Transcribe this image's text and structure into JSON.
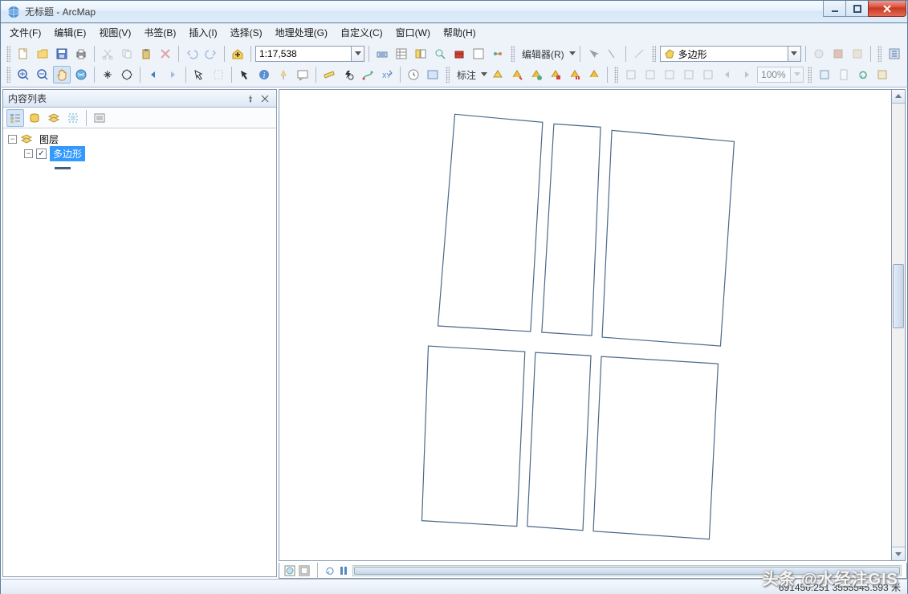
{
  "window": {
    "title": "无标题 - ArcMap"
  },
  "menu": [
    "文件(F)",
    "编辑(E)",
    "视图(V)",
    "书签(B)",
    "插入(I)",
    "选择(S)",
    "地理处理(G)",
    "自定义(C)",
    "窗口(W)",
    "帮助(H)"
  ],
  "toolbar": {
    "scale": "1:17,538",
    "editor_label": "编辑器(R)",
    "labeling_label": "标注",
    "feature_template": "多边形",
    "zoom_pct": "100%"
  },
  "toc": {
    "title": "内容列表",
    "root": "图层",
    "layer": "多边形"
  },
  "status": {
    "coords": "691450.251  3555545.593 米"
  },
  "watermark": "头条 @水经注GIS"
}
